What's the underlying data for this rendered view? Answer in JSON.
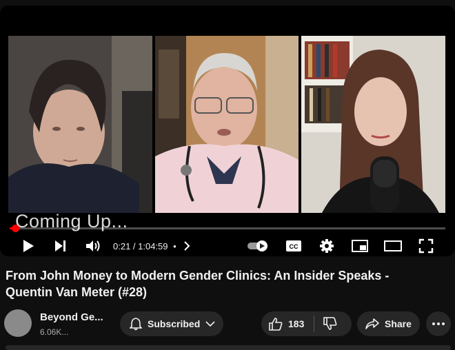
{
  "player": {
    "overlay_text": "Coming Up...",
    "current_time": "0:21",
    "duration": "1:04:59",
    "time_display": "0:21 / 1:04:59",
    "progress_fraction": 0.005,
    "accent_color": "#ff0000",
    "controls": [
      "play-icon",
      "next-icon",
      "volume-icon",
      "chapters-icon",
      "autoplay-toggle",
      "captions-icon",
      "settings-icon",
      "miniplayer-icon",
      "theater-icon",
      "fullscreen-icon"
    ],
    "captions_label": "CC"
  },
  "video": {
    "title": "From John Money to Modern Gender Clinics: An Insider Speaks - Quentin Van Meter (#28)"
  },
  "channel": {
    "name": "Beyond Ge...",
    "subscribers": "6.06K..."
  },
  "actions": {
    "subscribe_label": "Subscribed",
    "like_count": "183",
    "share_label": "Share"
  }
}
